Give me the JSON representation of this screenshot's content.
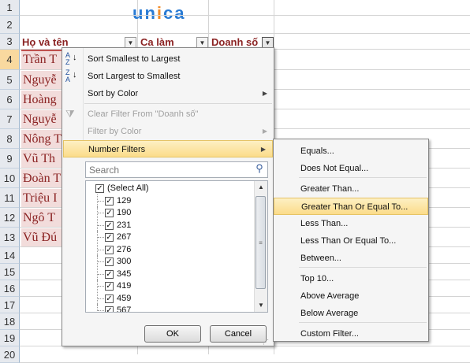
{
  "logo": {
    "letters": [
      "u",
      "n",
      "i",
      "c",
      "a"
    ],
    "colors": [
      "#2a7bd4",
      "#2a7bd4",
      "#f28c28",
      "#2a7bd4",
      "#2a7bd4"
    ]
  },
  "row_numbers": [
    "1",
    "2",
    "3",
    "4",
    "5",
    "6",
    "7",
    "8",
    "9",
    "10",
    "11",
    "12",
    "13",
    "14",
    "15",
    "16",
    "17",
    "18",
    "19",
    "20"
  ],
  "headers": {
    "name": "Họ và tên",
    "shift": "Ca làm",
    "sales": "Doanh số"
  },
  "names": [
    "Trần T",
    "Nguyễ",
    "Hoàng",
    "Nguyễ",
    "Nông T",
    "Vũ Th",
    "Đoàn T",
    "Triệu I",
    "Ngô T",
    "Vũ Đú"
  ],
  "menu": {
    "sort_asc": "Sort Smallest to Largest",
    "sort_desc": "Sort Largest to Smallest",
    "sort_color": "Sort by Color",
    "clear_filter": "Clear Filter From \"Doanh số\"",
    "filter_color": "Filter by Color",
    "number_filters": "Number Filters",
    "search_placeholder": "Search",
    "list": [
      "(Select All)",
      "129",
      "190",
      "231",
      "267",
      "276",
      "300",
      "345",
      "419",
      "459",
      "567"
    ],
    "ok": "OK",
    "cancel": "Cancel"
  },
  "submenu": {
    "items": [
      "Equals...",
      "Does Not Equal...",
      "Greater Than...",
      "Greater Than Or Equal To...",
      "Less Than...",
      "Less Than Or Equal To...",
      "Between...",
      "Top 10...",
      "Above Average",
      "Below Average",
      "Custom Filter..."
    ]
  },
  "colors": {
    "accent_name": "#8b2323",
    "name_fill": "#f2dcdb",
    "hover": "#fbdc8a"
  }
}
